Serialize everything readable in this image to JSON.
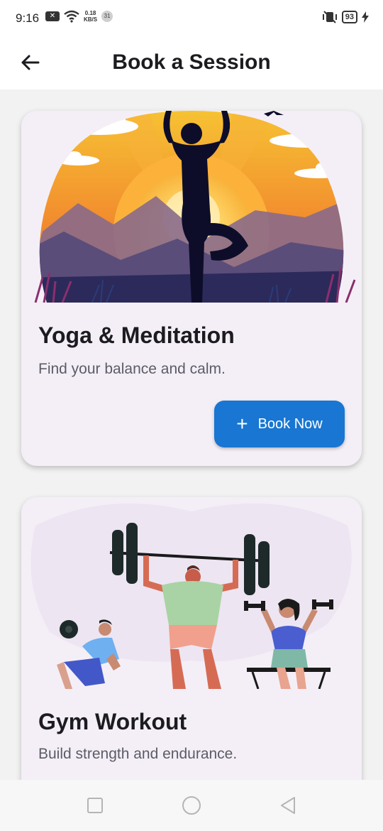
{
  "status_bar": {
    "time": "9:16",
    "speed_value": "0.18",
    "speed_unit": "KB/S",
    "notification_count": "31",
    "battery": "93"
  },
  "app_bar": {
    "title": "Book a Session",
    "back_icon": "arrow-left-icon"
  },
  "sessions": [
    {
      "title": "Yoga & Meditation",
      "subtitle": "Find your balance and calm.",
      "button_label": "Book Now",
      "button_icon": "plus-icon",
      "accent_color": "#1976d2"
    },
    {
      "title": "Gym Workout",
      "subtitle": "Build strength and endurance."
    }
  ],
  "nav_bar": {
    "items": [
      "square-icon",
      "circle-icon",
      "triangle-back-icon"
    ]
  }
}
